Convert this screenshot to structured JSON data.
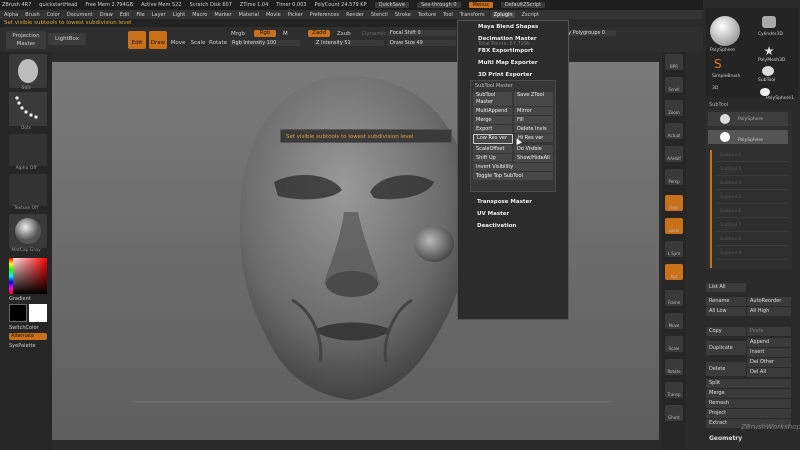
{
  "titlebar": {
    "app": "ZBrush 4R7",
    "doc": "quickstartHead",
    "free_mem": "Free Mem 2.794GB",
    "active_mem": "Active Mem 522",
    "scratch_disk": "Scratch Disk 607",
    "ztime": "ZTime 1.04",
    "timer": "Timer 0.003",
    "polycount": "PolyCount 24.579 KP",
    "quicksave": "QuickSave",
    "see_through": "See-through 0",
    "menus": "Menus",
    "default_script": "DefaultZScript"
  },
  "menubar": {
    "items": [
      "Alpha",
      "Brush",
      "Color",
      "Document",
      "Draw",
      "Edit",
      "File",
      "Layer",
      "Light",
      "Macro",
      "Marker",
      "Material",
      "Movie",
      "Picker",
      "Preferences",
      "Render",
      "Stencil",
      "Stroke",
      "Texture",
      "Tool",
      "Transform",
      "Zplugin",
      "Zscript"
    ],
    "active_index": 21
  },
  "notebar": {
    "text": "Set visible subtools to lowest subdivision level"
  },
  "toolbar": {
    "projection_master": "Projection Master",
    "lightbox": "LightBox",
    "edit": "Edit",
    "draw": "Draw",
    "move": "Move",
    "scale": "Scale",
    "rotate": "Rotate",
    "mrgb": "Mrgb",
    "rgb": "Rgb",
    "m": "M",
    "rgb_intensity": "Rgb Intensity 100",
    "zadd": "Zadd",
    "zsub": "Zsub",
    "z_intensity": "Z Intensity 51",
    "focal_shift": "Focal Shift 0",
    "draw_size": "Draw Size 49",
    "dynamic": "Dynamic",
    "mesh_polygroups": "Mesh By Polygroups 0"
  },
  "leftshelf": {
    "brush_caption": "Sdit",
    "stroke_caption": "Dots",
    "alpha_caption": "Alpha Off",
    "texture_caption": "Texture Off",
    "material_caption": "MatCap Gray",
    "gradient": "Gradient",
    "switch_color": "SwitchColor",
    "alternate": "Alternate",
    "syepalette": "SyePalette"
  },
  "rshelf": {
    "items": [
      "BPR",
      "Scroll",
      "Zoom",
      "Actual",
      "AAHalf",
      "Persp",
      "Floor",
      "Local",
      "L.Sym",
      "Xyz",
      "Frame",
      "Move",
      "Scale",
      "Rotate",
      "Transp",
      "Ghost"
    ]
  },
  "rpanel": {
    "tools": [
      "PolySphere",
      "Cylinder3D",
      "SimpleBrush",
      "PolyMesh3D",
      "SubTool",
      "PolySphere1"
    ],
    "tool_caption": "3D",
    "subtool_title": "SubTool",
    "subtool_rows": [
      "PolySphere",
      "PolySphere"
    ],
    "empty_rows": [
      "Subtool 2",
      "Subtool 3",
      "Subtool 4",
      "Subtool 5",
      "Subtool 6",
      "Subtool 7",
      "Subtool 8",
      "Subtool 9"
    ],
    "list_all": "List All",
    "rename": "Rename",
    "autoreorder": "AutoReorder",
    "all_low": "All Low",
    "all_high": "All High",
    "copy": "Copy",
    "paste": "Paste",
    "duplicate": "Duplicate",
    "append": "Append",
    "insert": "Insert",
    "delete": "Delete",
    "del_other": "Del Other",
    "del_all": "Del All",
    "split": "Split",
    "merge": "Merge",
    "remesh": "Remesh",
    "project": "Project",
    "extract": "Extract",
    "geometry": "Geometry",
    "watermark": "ZBrushWorkshop"
  },
  "zplugin_menu": {
    "items_top": [
      "Maya Blend Shapes",
      "Decimation Master",
      "FBX ExportImport",
      "Multi Map Exporter",
      "3D Print Exporter"
    ],
    "overlay_text": "Total Points: 67.729k",
    "subtool_master_title": "SubTool Master",
    "buttons": [
      [
        "SubTool Master",
        "Save ZTool"
      ],
      [
        "MultiAppend",
        "Mirror"
      ],
      [
        "Merge",
        "Fill"
      ],
      [
        "Export",
        "Delete Invis"
      ],
      [
        "Low Res ver",
        "Hi Res ver"
      ],
      [
        "ScaleOffset",
        "Do Visible"
      ],
      [
        "Shift Up",
        "Show/HideAll"
      ]
    ],
    "invert_visibility": "Invert Visibility",
    "toggle_top": "Toggle Top SubTool",
    "items_bottom": [
      "Transpose Master",
      "UV Master",
      "Deactivation"
    ]
  },
  "tooltip": {
    "text": "Set visible subtools to lowest subdivision level"
  },
  "colors": {
    "accent": "#c9701b",
    "note": "#e0a23a"
  }
}
